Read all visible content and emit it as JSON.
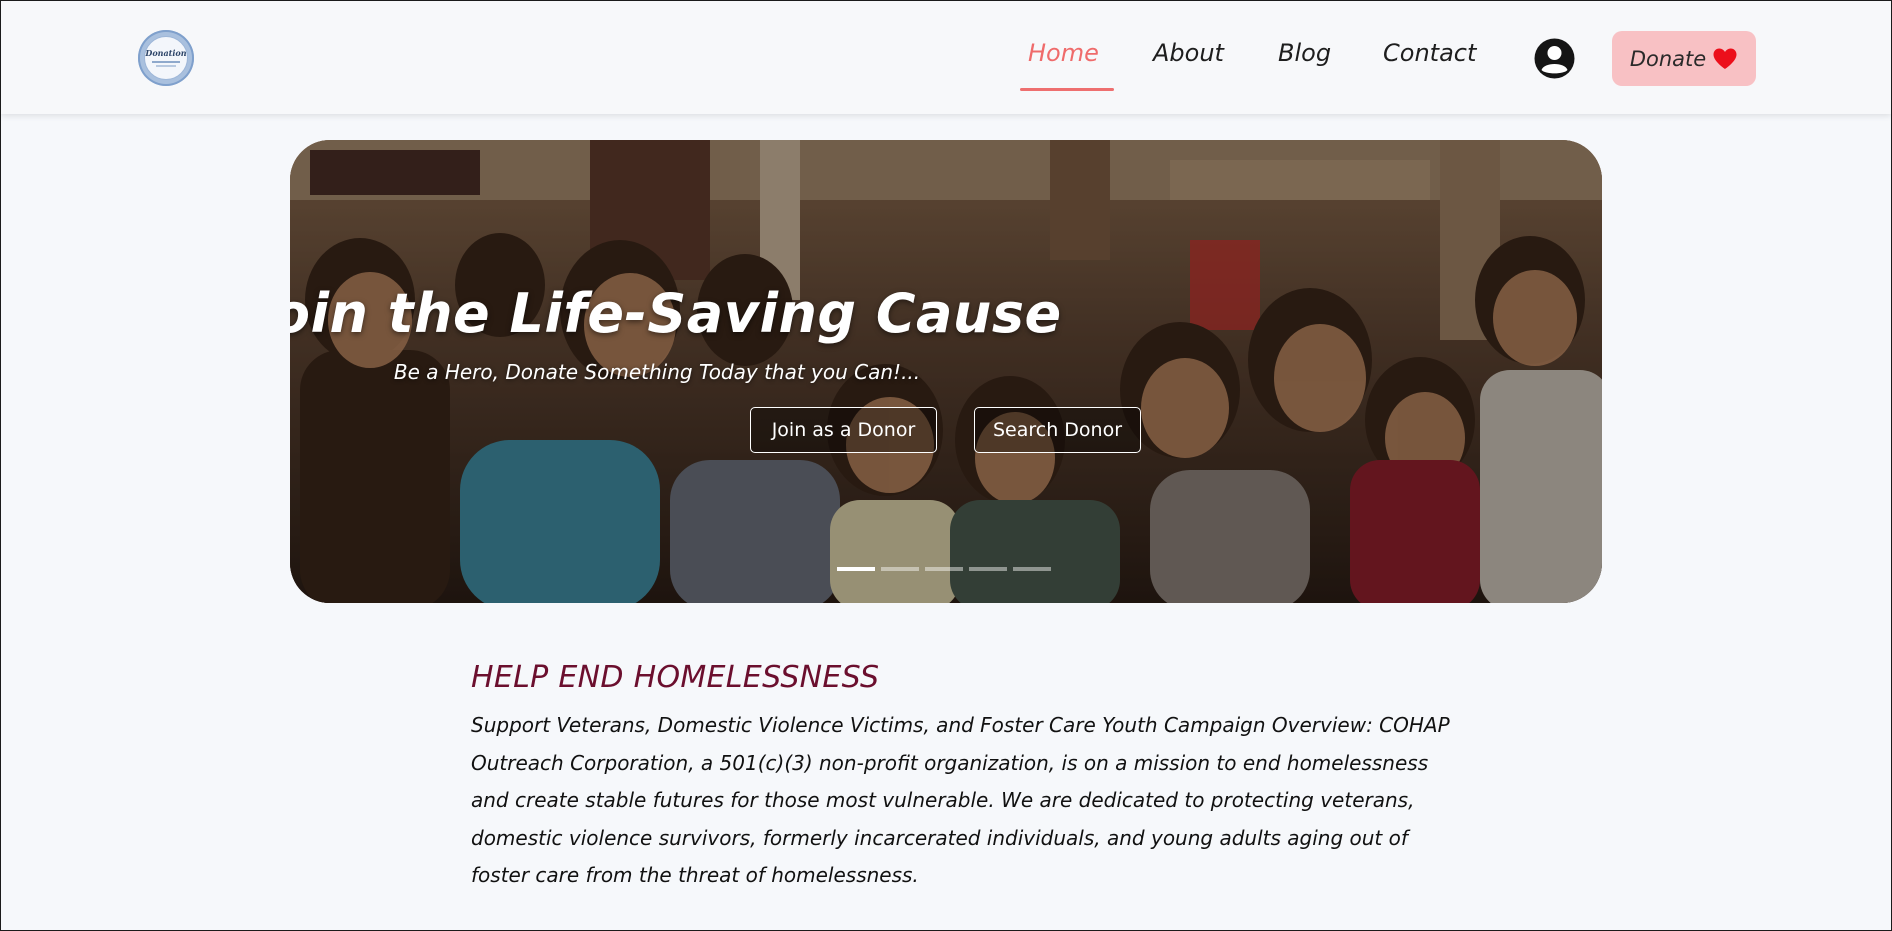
{
  "nav": {
    "logo_text": "Donation",
    "links": [
      {
        "label": "Home",
        "active": true
      },
      {
        "label": "About",
        "active": false
      },
      {
        "label": "Blog",
        "active": false
      },
      {
        "label": "Contact",
        "active": false
      }
    ],
    "account_icon": "user-circle-icon",
    "donate_label": "Donate",
    "donate_icon": "heart-icon",
    "active_color": "#ef6b6b",
    "donate_bg": "#f8c1c4"
  },
  "hero": {
    "title": "Join the Life-Saving Cause",
    "subtitle": "Be a Hero, Donate Something Today that you Can!...",
    "primary_button": "Join as a Donor",
    "secondary_button": "Search Donor",
    "carousel": {
      "slides": 5,
      "active_index": 0
    }
  },
  "section": {
    "title": "HELP END HOMELESSNESS",
    "title_color": "#6b0f2e",
    "body": "Support Veterans, Domestic Violence Victims, and Foster Care Youth Campaign Overview: COHAP Outreach Corporation, a 501(c)(3) non-profit organization, is on a mission to end homelessness and create stable futures for those most vulnerable. We are dedicated to protecting veterans, domestic violence survivors, formerly incarcerated individuals, and young adults aging out of foster care from the threat of homelessness."
  }
}
